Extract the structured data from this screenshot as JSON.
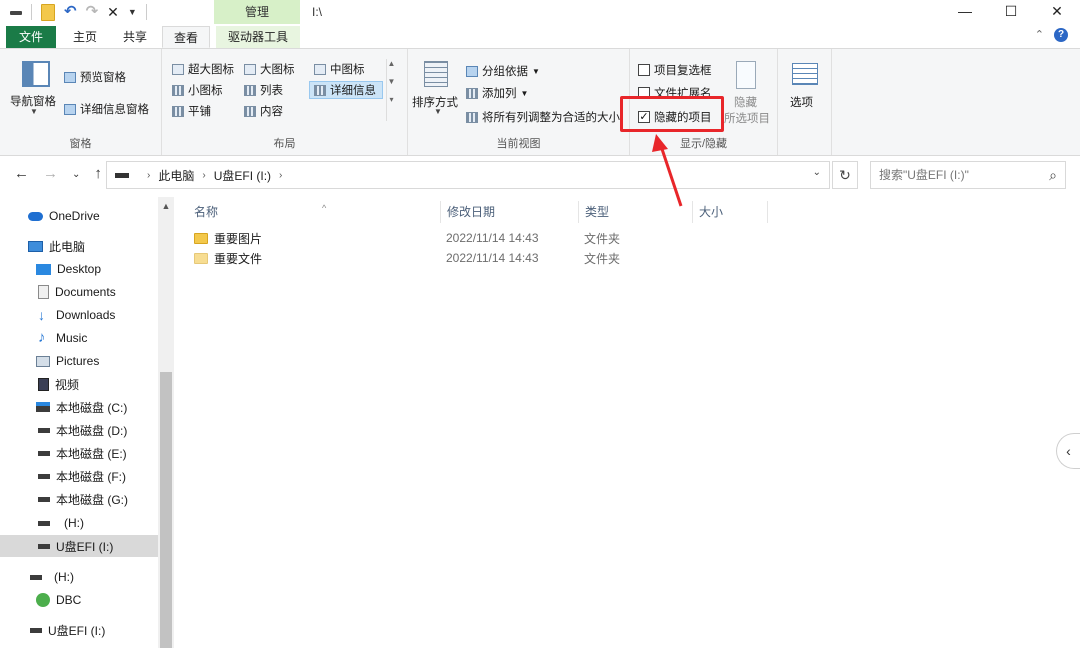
{
  "titlebar": {
    "tool_tab": "管理",
    "path": "I:\\",
    "minimize": "—",
    "maximize": "☐",
    "close": "✕"
  },
  "ribbon_tabs": {
    "file": "文件",
    "home": "主页",
    "share": "共享",
    "view": "查看",
    "drive_tools": "驱动器工具"
  },
  "ribbon": {
    "panes": {
      "label": "窗格",
      "navigation_pane": "导航窗格",
      "preview_pane": "预览窗格",
      "details_pane": "详细信息窗格"
    },
    "layout": {
      "label": "布局",
      "extra_large_icons": "超大图标",
      "large_icons": "大图标",
      "medium_icons": "中图标",
      "small_icons": "小图标",
      "list": "列表",
      "details": "详细信息",
      "tiles": "平铺",
      "content": "内容"
    },
    "current_view": {
      "label": "当前视图",
      "sort_by": "排序方式",
      "group_by": "分组依据",
      "add_columns": "添加列",
      "size_all_columns": "将所有列调整为合适的大小"
    },
    "show_hide": {
      "label": "显示/隐藏",
      "item_check_boxes": "项目复选框",
      "file_name_extensions": "文件扩展名",
      "hidden_items": "隐藏的项目",
      "hide_selected_line1": "隐藏",
      "hide_selected_line2": "所选项目",
      "options": "选项",
      "item_check_boxes_checked": false,
      "file_name_extensions_checked": false,
      "hidden_items_checked": true
    }
  },
  "address": {
    "breadcrumb": [
      "此电脑",
      "U盘EFI (I:)"
    ],
    "search_placeholder": "搜索\"U盘EFI (I:)\""
  },
  "nav": {
    "items": [
      {
        "label": "OneDrive",
        "icon": "onedrive-icon"
      },
      {
        "label": "此电脑",
        "icon": "computer-icon"
      },
      {
        "label": "Desktop",
        "icon": "desktop-icon"
      },
      {
        "label": "Documents",
        "icon": "documents-icon"
      },
      {
        "label": "Downloads",
        "icon": "downloads-icon"
      },
      {
        "label": "Music",
        "icon": "music-icon"
      },
      {
        "label": "Pictures",
        "icon": "pictures-icon"
      },
      {
        "label": "视频",
        "icon": "videos-icon"
      },
      {
        "label": "本地磁盘 (C:)",
        "icon": "system-drive-icon"
      },
      {
        "label": "本地磁盘 (D:)",
        "icon": "drive-icon"
      },
      {
        "label": "本地磁盘 (E:)",
        "icon": "drive-icon"
      },
      {
        "label": "本地磁盘 (F:)",
        "icon": "drive-icon"
      },
      {
        "label": "本地磁盘 (G:)",
        "icon": "drive-icon"
      },
      {
        "label": "(H:)",
        "icon": "drive-icon"
      },
      {
        "label": "U盘EFI (I:)",
        "icon": "drive-icon"
      },
      {
        "label": "(H:)",
        "icon": "drive-icon"
      },
      {
        "label": "DBC",
        "icon": "dbc-icon"
      },
      {
        "label": "U盘EFI (I:)",
        "icon": "drive-icon"
      }
    ]
  },
  "files": {
    "columns": [
      "名称",
      "修改日期",
      "类型",
      "大小"
    ],
    "rows": [
      {
        "name": "重要图片",
        "date": "2022/11/14 14:43",
        "type": "文件夹"
      },
      {
        "name": "重要文件",
        "date": "2022/11/14 14:43",
        "type": "文件夹"
      }
    ]
  },
  "colors": {
    "file_tab": "#1a7b47",
    "tool_tab": "#d7f0c8",
    "highlight": "#e8262a",
    "selection": "#cce4f7"
  }
}
